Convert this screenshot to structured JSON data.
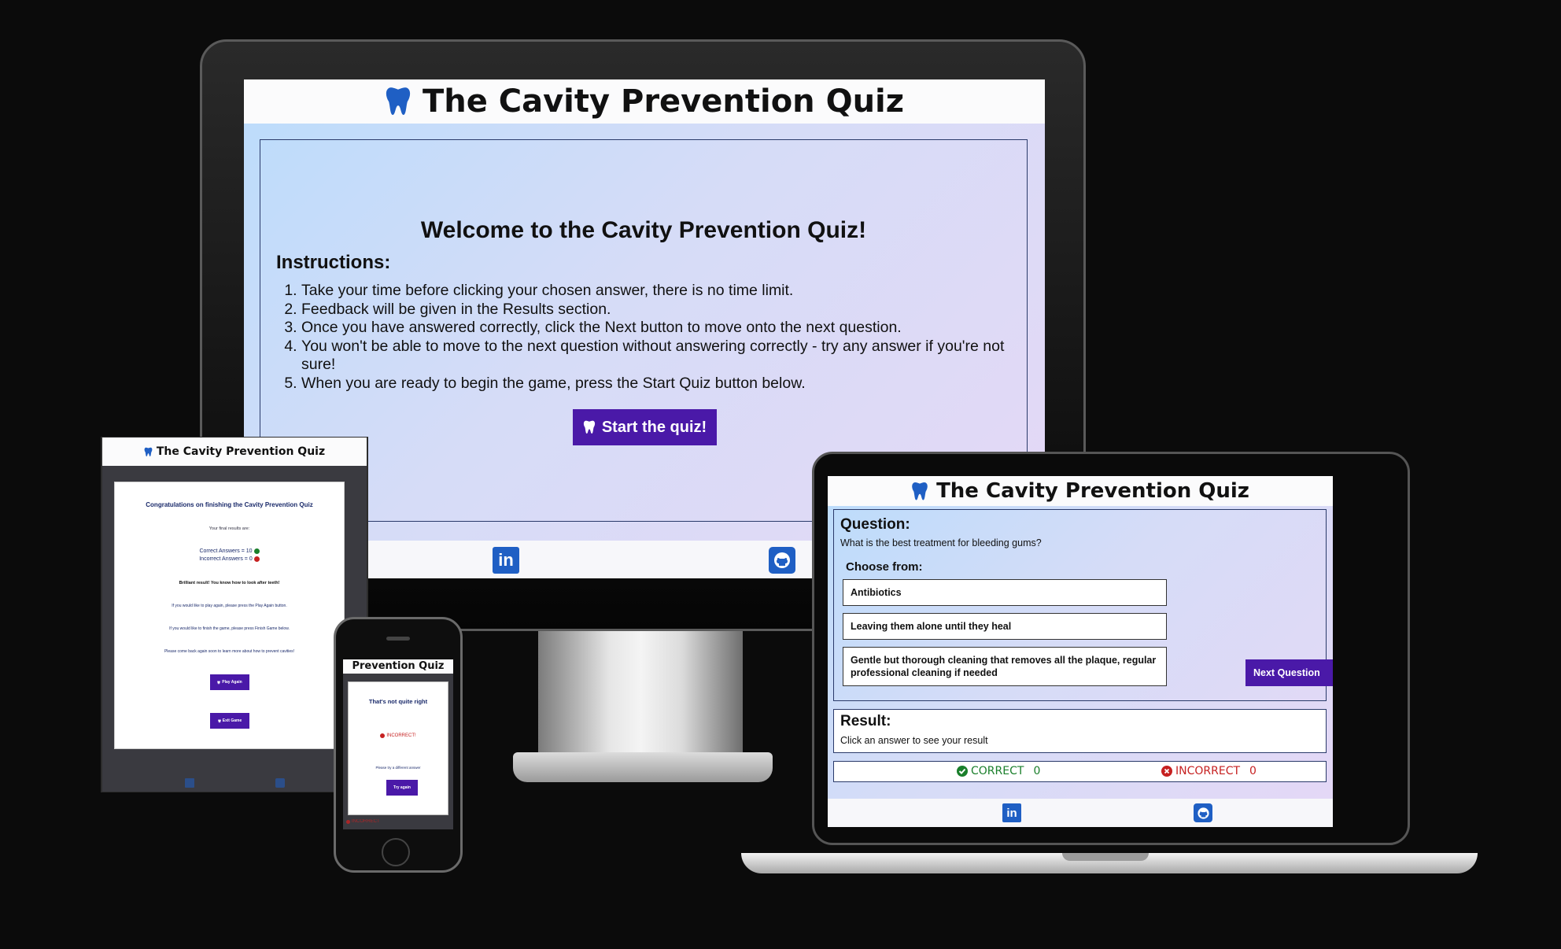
{
  "app": {
    "title": "The Cavity Prevention Quiz"
  },
  "monitor": {
    "welcome": "Welcome to the Cavity Prevention Quiz!",
    "instructions_heading": "Instructions:",
    "instructions": [
      "Take your time before clicking your chosen answer, there is no time limit.",
      "Feedback will be given in the Results section.",
      "Once you have answered correctly, click the Next button to move onto the next question.",
      "You won't be able to move to the next question without answering correctly - try any answer if you're not sure!",
      "When you are ready to begin the game, press the Start Quiz button below."
    ],
    "start_button": "Start the quiz!"
  },
  "laptop": {
    "question_heading": "Question:",
    "question": "What is the best treatment for bleeding gums?",
    "choose_heading": "Choose from:",
    "answers": [
      "Antibiotics",
      "Leaving them alone until they heal",
      "Gentle but thorough cleaning that removes all the plaque, regular professional cleaning if needed"
    ],
    "next_button": "Next Question",
    "result_heading": "Result:",
    "result_text": "Click an answer to see your result",
    "correct_label": "CORRECT",
    "correct_count": "0",
    "incorrect_label": "INCORRECT",
    "incorrect_count": "0"
  },
  "tablet": {
    "heading": "Congratulations on finishing the Cavity Prevention Quiz",
    "results_intro": "Your final results are:",
    "correct_line": "Correct Answers = 10",
    "incorrect_line": "Incorrect Answers = 0",
    "praise": "Brilliant result! You know how to look after teeth!",
    "play_again_text": "If you would like to play again, please press the Play Again button.",
    "finish_text": "If you would like to finish the game, please press Finish Game below.",
    "come_back_text": "Please come back again soon to learn more about how to prevent cavities!",
    "play_again_button": "Play Again",
    "exit_button": "Exit Game"
  },
  "phone": {
    "title": "Prevention Quiz",
    "heading": "That's not quite right",
    "incorrect_label": "INCORRECT!",
    "hint": "Please try a different answer",
    "try_again_button": "Try again",
    "footer_label": "INCORRECT"
  },
  "colors": {
    "accent": "#4a19a8",
    "tooth": "#1f5fc4",
    "correct": "#1a7f2b",
    "incorrect": "#c62121"
  },
  "icons": [
    "tooth-icon",
    "linkedin-icon",
    "github-icon",
    "check-circle-icon",
    "x-circle-icon"
  ]
}
